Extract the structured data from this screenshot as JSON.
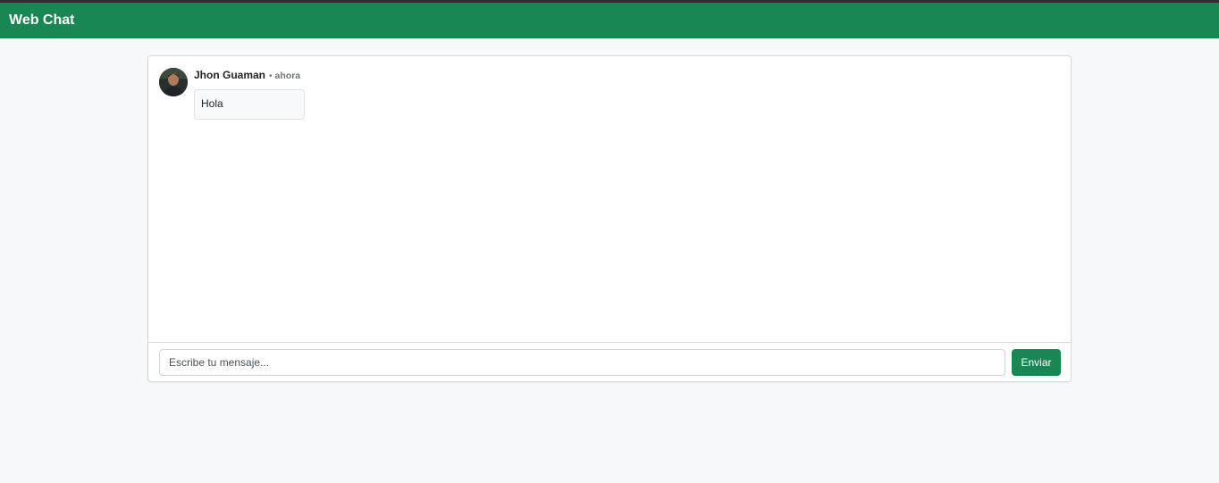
{
  "navbar": {
    "brand": "Web Chat",
    "color": "#198754"
  },
  "messages": [
    {
      "author": "Jhon Guaman",
      "separator": "•",
      "time": "ahora",
      "text": "Hola",
      "avatar_icon": "user-photo-avatar"
    }
  ],
  "composer": {
    "placeholder": "Escribe tu mensaje...",
    "value": "",
    "send_label": "Enviar"
  }
}
